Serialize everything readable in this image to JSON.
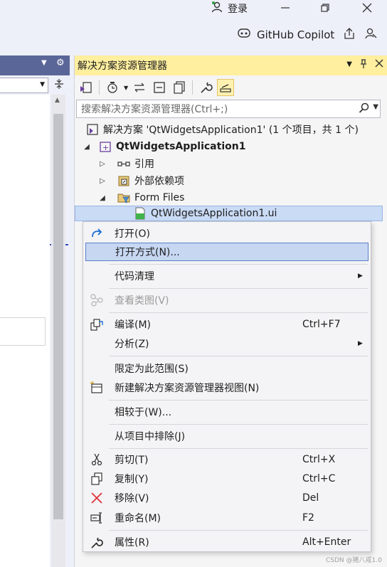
{
  "titlebar": {
    "login_label": "登录",
    "copilot_label": "GitHub Copilot"
  },
  "solution_explorer": {
    "title": "解决方案资源管理器",
    "search_placeholder": "搜索解决方案资源管理器(Ctrl+;)",
    "tree": {
      "solution": "解决方案 'QtWidgetsApplication1' (1 个项目，共 1 个)",
      "project": "QtWidgetsApplication1",
      "references": "引用",
      "external_deps": "外部依赖项",
      "form_files": "Form Files",
      "ui_file": "QtWidgetsApplication1.ui"
    }
  },
  "context_menu": {
    "items": [
      {
        "label": "打开(O)",
        "key": ""
      },
      {
        "label": "打开方式(N)...",
        "key": ""
      },
      {
        "label": "代码清理",
        "key": ""
      },
      {
        "label": "查看类图(V)",
        "key": ""
      },
      {
        "label": "编译(M)",
        "key": "Ctrl+F7"
      },
      {
        "label": "分析(Z)",
        "key": ""
      },
      {
        "label": "限定为此范围(S)",
        "key": ""
      },
      {
        "label": "新建解决方案资源管理器视图(N)",
        "key": ""
      },
      {
        "label": "相较于(W)...",
        "key": ""
      },
      {
        "label": "从项目中排除(J)",
        "key": ""
      },
      {
        "label": "剪切(T)",
        "key": "Ctrl+X"
      },
      {
        "label": "复制(Y)",
        "key": "Ctrl+C"
      },
      {
        "label": "移除(V)",
        "key": "Del"
      },
      {
        "label": "重命名(M)",
        "key": "F2"
      },
      {
        "label": "属性(R)",
        "key": "Alt+Enter"
      }
    ]
  },
  "watermark": "CSDN @猪八戒1.0",
  "colors": {
    "title_bar_bg": "#eef0f9",
    "panel_header_active": "#ffef9e",
    "selection": "#c7d7f2",
    "accent_blue": "#3048b8",
    "remove_red": "#e0303a"
  }
}
